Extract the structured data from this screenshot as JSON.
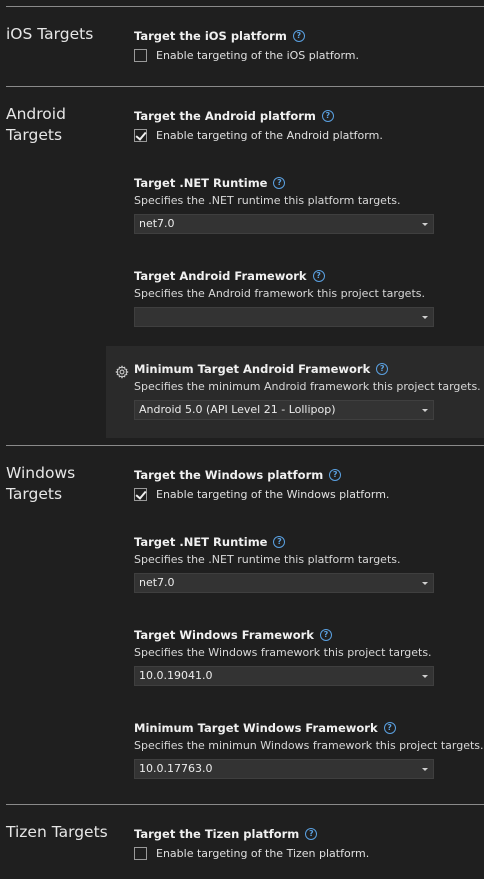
{
  "ios": {
    "title": "iOS Targets",
    "platform": {
      "title": "Target the iOS platform",
      "checkbox_label": "Enable targeting of the iOS platform.",
      "checked": false
    }
  },
  "android": {
    "title_line1": "Android",
    "title_line2": "Targets",
    "platform": {
      "title": "Target the Android platform",
      "checkbox_label": "Enable targeting of the Android platform.",
      "checked": true
    },
    "runtime": {
      "title": "Target .NET Runtime",
      "desc": "Specifies the .NET runtime this platform targets.",
      "value": "net7.0"
    },
    "framework": {
      "title": "Target Android Framework",
      "desc": "Specifies the Android framework this project targets.",
      "value": ""
    },
    "min_framework": {
      "title": "Minimum Target Android Framework",
      "desc": "Specifies the minimum Android framework this project targets.",
      "value": "Android 5.0 (API Level 21 - Lollipop)"
    }
  },
  "windows": {
    "title_line1": "Windows",
    "title_line2": "Targets",
    "platform": {
      "title": "Target the Windows platform",
      "checkbox_label": "Enable targeting of the Windows platform.",
      "checked": true
    },
    "runtime": {
      "title": "Target .NET Runtime",
      "desc": "Specifies the .NET runtime this platform targets.",
      "value": "net7.0"
    },
    "framework": {
      "title": "Target Windows Framework",
      "desc": "Specifies the Windows framework this project targets.",
      "value": "10.0.19041.0"
    },
    "min_framework": {
      "title": "Minimum Target Windows Framework",
      "desc": "Specifies the minimun Windows framework this project targets.",
      "value": "10.0.17763.0"
    }
  },
  "tizen": {
    "title": "Tizen Targets",
    "platform": {
      "title": "Target the Tizen platform",
      "checkbox_label": "Enable targeting of the Tizen platform.",
      "checked": false
    }
  },
  "icons": {
    "help": "help-circle-icon",
    "gear": "gear-icon",
    "dropdown": "chevron-down-icon"
  },
  "colors": {
    "background": "#1f1f1f",
    "divider": "#8a8a8a",
    "help_accent": "#5aa0e0",
    "dropdown_bg": "#333333",
    "highlight_bg": "#2a2a2a"
  }
}
